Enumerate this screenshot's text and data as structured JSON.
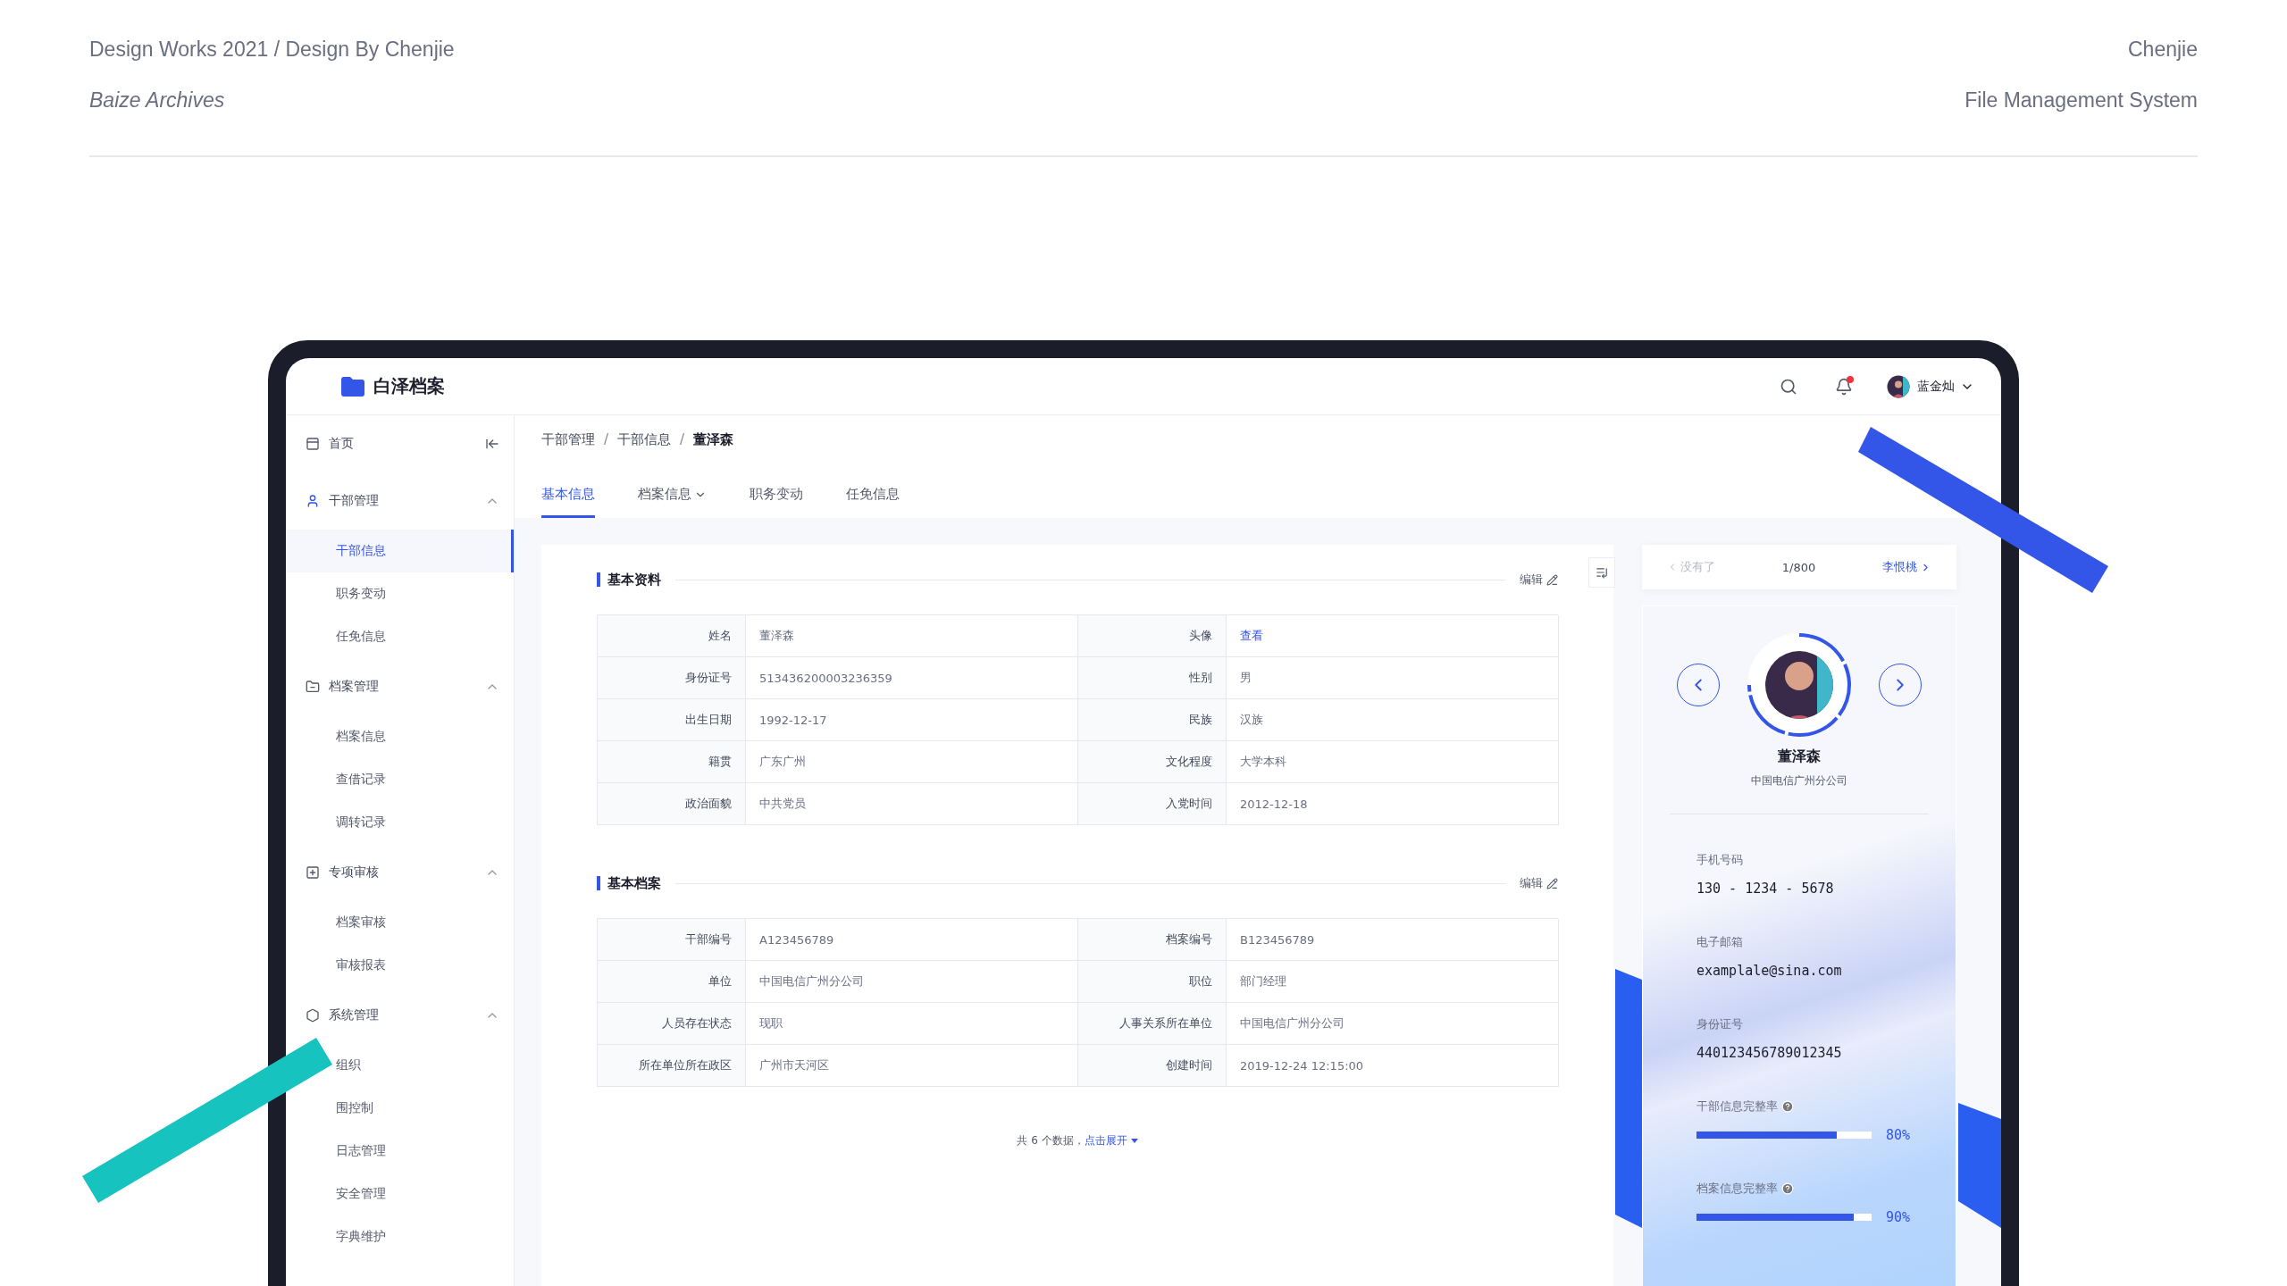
{
  "showcase": {
    "title": "Design Works 2021 / Design By Chenjie",
    "subtitle": "Baize Archives",
    "author": "Chenjie",
    "product": "File Management System"
  },
  "app": {
    "name": "白泽档案"
  },
  "user": {
    "name": "蓝金灿",
    "notification": true
  },
  "sidebar": [
    {
      "label": "首页"
    },
    {
      "label": "干部管理",
      "expanded": true,
      "children": [
        {
          "label": "干部信息",
          "selected": true
        },
        {
          "label": "职务变动",
          "selected": false
        },
        {
          "label": "任免信息",
          "selected": false
        }
      ]
    },
    {
      "label": "档案管理",
      "expanded": true,
      "children": [
        {
          "label": "档案信息",
          "selected": false
        },
        {
          "label": "查借记录",
          "selected": false
        },
        {
          "label": "调转记录",
          "selected": false
        }
      ]
    },
    {
      "label": "专项审核",
      "expanded": true,
      "children": [
        {
          "label": "档案审核",
          "selected": false
        },
        {
          "label": "审核报表",
          "selected": false
        }
      ]
    },
    {
      "label": "系统管理",
      "expanded": true,
      "children": [
        {
          "label": "组织",
          "selected": false
        },
        {
          "label": "围控制",
          "selected": false
        },
        {
          "label": "日志管理",
          "selected": false
        },
        {
          "label": "安全管理",
          "selected": false
        },
        {
          "label": "字典维护",
          "selected": false
        }
      ]
    }
  ],
  "breadcrumb": {
    "separator": "/",
    "items": [
      "干部管理",
      "干部信息",
      "董泽森"
    ]
  },
  "tabs": [
    {
      "label": "基本信息",
      "selected": true,
      "dropdown": false
    },
    {
      "label": "档案信息",
      "selected": false,
      "dropdown": true
    },
    {
      "label": "职务变动",
      "selected": false,
      "dropdown": false
    },
    {
      "label": "任免信息",
      "selected": false,
      "dropdown": false
    }
  ],
  "sections": [
    {
      "title": "基本资料",
      "action": "编辑",
      "rows": [
        [
          {
            "label": "姓名",
            "value": "董泽森",
            "link": false
          },
          {
            "label": "头像",
            "value": "查看",
            "link": true
          }
        ],
        [
          {
            "label": "身份证号",
            "value": "513436200003236359",
            "link": false
          },
          {
            "label": "性别",
            "value": "男",
            "link": false
          }
        ],
        [
          {
            "label": "出生日期",
            "value": "1992-12-17",
            "link": false
          },
          {
            "label": "民族",
            "value": "汉族",
            "link": false
          }
        ],
        [
          {
            "label": "籍贯",
            "value": "广东广州",
            "link": false
          },
          {
            "label": "文化程度",
            "value": "大学本科",
            "link": false
          }
        ],
        [
          {
            "label": "政治面貌",
            "value": "中共党员",
            "link": false
          },
          {
            "label": "入党时间",
            "value": "2012-12-18",
            "link": false
          }
        ]
      ]
    },
    {
      "title": "基本档案",
      "action": "编辑",
      "rows": [
        [
          {
            "label": "干部编号",
            "value": "A123456789",
            "link": false
          },
          {
            "label": "档案编号",
            "value": "B123456789",
            "link": false
          }
        ],
        [
          {
            "label": "单位",
            "value": "中国电信广州分公司",
            "link": false
          },
          {
            "label": "职位",
            "value": "部门经理",
            "link": false
          }
        ],
        [
          {
            "label": "人员存在状态",
            "value": "现职",
            "link": false
          },
          {
            "label": "人事关系所在单位",
            "value": "中国电信广州分公司",
            "link": false
          }
        ],
        [
          {
            "label": "所在单位所在政区",
            "value": "广州市天河区",
            "link": false
          },
          {
            "label": "创建时间",
            "value": "2019-12-24  12:15:00",
            "link": false
          }
        ]
      ]
    }
  ],
  "footer": {
    "text": "共 6 个数据，",
    "link": "点击展开"
  },
  "pager": {
    "prev": "没有了",
    "prev_disabled": true,
    "position": "1/800",
    "next": "李恨桃"
  },
  "profile": {
    "name": "董泽森",
    "company": "中国电信广州分公司",
    "fields": [
      {
        "label": "手机号码",
        "value": "130 - 1234 - 5678"
      },
      {
        "label": "电子邮箱",
        "value": "examplale@sina.com"
      },
      {
        "label": "身份证号",
        "value": "440123456789012345"
      }
    ],
    "rates": [
      {
        "label": "干部信息完整率",
        "level": 0.8,
        "reading": "80%"
      },
      {
        "label": "档案信息完整率",
        "level": 0.9,
        "reading": "90%"
      }
    ]
  }
}
